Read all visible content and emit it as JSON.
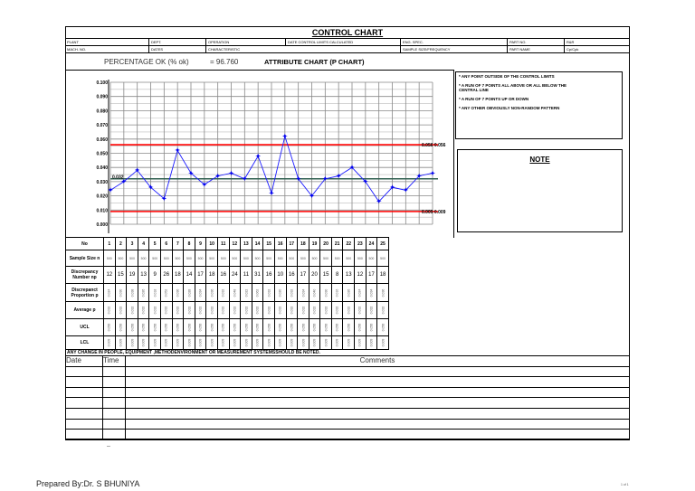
{
  "title": "CONTROL  CHART",
  "header": {
    "row1": [
      "PLANT",
      "DEPT.",
      "OPERATION",
      "DATE CONTROL LIMITS CALCULATED",
      "ENG. SPEC.",
      "PART NO.",
      "R&R"
    ],
    "row2": [
      "MACH. NO.",
      "DATES",
      "CHARACTERISTIC",
      "",
      "SAMPLE SIZE/FREQUENCY",
      "PART NAME",
      "Cp/Cpk"
    ]
  },
  "percentage_label": "PERCENTAGE OK (% ok)",
  "percentage_value": "=  96.760",
  "chart_title": "ATTRIBUTE CHART (P CHART)",
  "rules": [
    "* ANY POINT OUTSIDE OF THE CONTROL LIMITS",
    "* A RUN OF 7 POINTS ALL ABOVE OR ALL BELOW THE CENTRAL LINE",
    "* A RUN OF 7 POINTS UP OR DOWN",
    "* ANY OTHER OBVIOUSLY NON-RANDOM PATTERN"
  ],
  "note_title": "NOTE",
  "chart_data": {
    "type": "line",
    "title": "ATTRIBUTE CHART (P CHART)",
    "x": [
      1,
      2,
      3,
      4,
      5,
      6,
      7,
      8,
      9,
      10,
      11,
      12,
      13,
      14,
      15,
      16,
      17,
      18,
      19,
      20,
      21,
      22,
      23,
      24,
      25
    ],
    "series": [
      {
        "name": "p",
        "values": [
          0.024,
          0.03,
          0.038,
          0.026,
          0.018,
          0.052,
          0.036,
          0.028,
          0.034,
          0.036,
          0.032,
          0.048,
          0.022,
          0.062,
          0.032,
          0.02,
          0.032,
          0.034,
          0.04,
          0.03,
          0.016,
          0.026,
          0.024,
          0.034,
          0.036
        ]
      }
    ],
    "ucl": 0.056,
    "lcl": 0.009,
    "center": 0.032,
    "ucl_label": "0.056 0.056",
    "lcl_label": "0.009 0.009",
    "center_label": "0.032",
    "ylim": [
      0,
      0.1
    ],
    "yticks": [
      "0.000",
      "0.010",
      "0.020",
      "0.030",
      "0.040",
      "0.050",
      "0.060",
      "0.070",
      "0.080",
      "0.090",
      "0.100"
    ],
    "grid": true,
    "colors": {
      "series": "#1a1aff",
      "limits": "#ff0000",
      "center": "#2f5f4f"
    }
  },
  "table": {
    "labels": {
      "no": "No",
      "n": "Sample Size n",
      "np": "Discrepancy Number np",
      "p": "Discrepanct Proportion p",
      "avg": "Average p",
      "ucl": "UCL",
      "lcl": "LCL"
    },
    "no": [
      1,
      2,
      3,
      4,
      5,
      6,
      7,
      8,
      9,
      10,
      11,
      12,
      13,
      14,
      15,
      16,
      17,
      18,
      19,
      20,
      21,
      22,
      23,
      24,
      25
    ],
    "n": [
      500,
      500,
      500,
      500,
      500,
      500,
      500,
      500,
      500,
      500,
      500,
      500,
      500,
      500,
      500,
      500,
      500,
      500,
      500,
      500,
      500,
      500,
      500,
      500,
      500
    ],
    "np": [
      12,
      15,
      19,
      13,
      9,
      26,
      18,
      14,
      17,
      18,
      16,
      24,
      11,
      31,
      16,
      10,
      16,
      17,
      20,
      15,
      8,
      13,
      12,
      17,
      18
    ],
    "p": [
      "0.024",
      "0.030",
      "0.038",
      "0.026",
      "0.018",
      "0.052",
      "0.036",
      "0.028",
      "0.034",
      "0.036",
      "0.032",
      "0.048",
      "0.022",
      "0.062",
      "0.032",
      "0.020",
      "0.032",
      "0.034",
      "0.040",
      "0.030",
      "0.016",
      "0.026",
      "0.024",
      "0.034",
      "0.036"
    ],
    "avg": "0.032",
    "ucl": "0.056",
    "lcl": "0.009"
  },
  "change_note": "ANY CHANGE IN PEOPLE, EQUIPMENT ,METHODENVIRONMENT OR MEASUREMENT SYSTEMSSHOULD BE NOTED.",
  "comments": {
    "date": "Date",
    "time": "Time",
    "comments": "Comments",
    "rows": 7
  },
  "dash": "–",
  "prepared_by": "Prepared By:Dr. S BHUNIYA",
  "page": "1 of 1"
}
